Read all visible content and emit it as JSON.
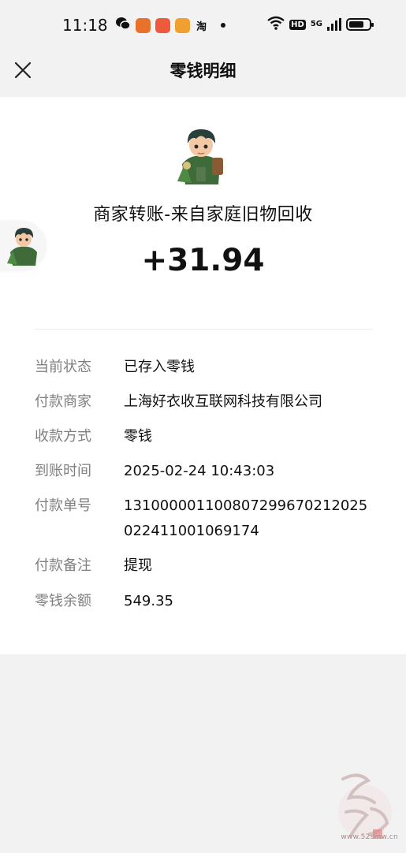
{
  "status_bar": {
    "time": "11:18",
    "taobao_label": "淘",
    "hd": "HD",
    "network": "5G",
    "battery_level": 0.75
  },
  "header": {
    "title": "零钱明细",
    "close_icon": "close-icon"
  },
  "transaction": {
    "merchant_title": "商家转账-来自家庭旧物回收",
    "amount": "+31.94"
  },
  "details": [
    {
      "label": "当前状态",
      "value": "已存入零钱"
    },
    {
      "label": "付款商家",
      "value": "上海好衣收互联网科技有限公司"
    },
    {
      "label": "收款方式",
      "value": "零钱"
    },
    {
      "label": "到账时间",
      "value": "2025-02-24 10:43:03"
    },
    {
      "label": "付款单号",
      "value": "131000001100807299670212025022411001069174"
    },
    {
      "label": "付款备注",
      "value": "提现"
    },
    {
      "label": "零钱余额",
      "value": "549.35"
    }
  ],
  "watermark": {
    "url": "www.52smw.cn"
  }
}
